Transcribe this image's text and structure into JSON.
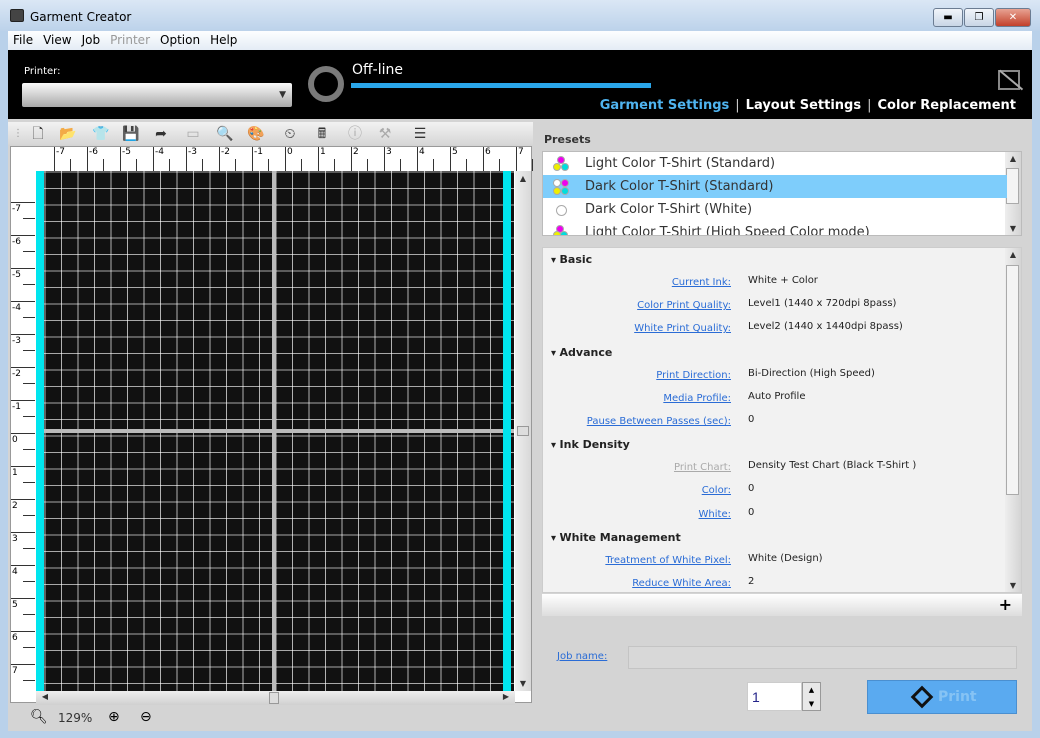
{
  "window": {
    "title": "Garment Creator",
    "minimize": "▬",
    "maximize": "❐",
    "close": "✕"
  },
  "menu": [
    "File",
    "View",
    "Job",
    "Printer",
    "Option",
    "Help"
  ],
  "menu_disabled": [
    "Printer"
  ],
  "header": {
    "printer_label": "Printer:",
    "printer_value": "",
    "status": "Off-line",
    "progress_percent": 100,
    "tabs": [
      {
        "label": "Garment Settings",
        "active": true
      },
      {
        "label": "Layout Settings",
        "active": false
      },
      {
        "label": "Color Replacement",
        "active": false
      }
    ]
  },
  "toolbar": [
    {
      "name": "new-icon",
      "glyph": "🗋"
    },
    {
      "name": "open-icon",
      "glyph": "📂"
    },
    {
      "name": "tshirt-icon",
      "glyph": "👕"
    },
    {
      "name": "save-icon",
      "glyph": "💾",
      "disabled": true
    },
    {
      "name": "export-icon",
      "glyph": "➦"
    },
    {
      "name": "frame-icon",
      "glyph": "▭",
      "disabled": true
    },
    {
      "name": "search-settings-icon",
      "glyph": "🔍"
    },
    {
      "name": "palette-icon",
      "glyph": "🎨"
    },
    {
      "name": "history-icon",
      "glyph": "⏲"
    },
    {
      "name": "calculator-icon",
      "glyph": "🖩"
    },
    {
      "name": "info-icon",
      "glyph": "ⓘ",
      "disabled": true
    },
    {
      "name": "maintenance-icon",
      "glyph": "⚒",
      "disabled": true
    },
    {
      "name": "checklist-icon",
      "glyph": "☰"
    }
  ],
  "ruler": {
    "top": [
      "-7",
      "-6",
      "-5",
      "-4",
      "-3",
      "-2",
      "-1",
      "0",
      "1",
      "2",
      "3",
      "4",
      "5",
      "6",
      "7"
    ],
    "left": [
      "-7",
      "-6",
      "-5",
      "-4",
      "-3",
      "-2",
      "-1",
      "0",
      "1",
      "2",
      "3",
      "4",
      "5",
      "6",
      "7"
    ]
  },
  "colors": {
    "platen": "#111111",
    "grid": "#ffffff",
    "guide": "#00e5ee",
    "accent": "#2aa6ea",
    "link": "#2a6cd6",
    "selected": "#7ecdfb",
    "print_button": "#5aaaf0"
  },
  "zoom": {
    "value": "129%"
  },
  "presets": {
    "label": "Presets",
    "items": [
      {
        "label": "Light Color T-Shirt (Standard)",
        "icon": "cmy-icon",
        "selected": false
      },
      {
        "label": "Dark Color T-Shirt (Standard)",
        "icon": "wcmy-icon",
        "selected": true
      },
      {
        "label": "Dark Color T-Shirt (White)",
        "icon": "white-circle-icon",
        "selected": false
      },
      {
        "label": "Light Color T-Shirt (High Speed Color mode)",
        "icon": "cmy-x2-icon",
        "selected": false
      }
    ]
  },
  "settings": [
    {
      "section": "Basic",
      "rows": [
        {
          "label": "Current Ink:",
          "value": "White + Color"
        },
        {
          "label": "Color Print Quality:",
          "value": "Level1 (1440 x 720dpi 8pass)"
        },
        {
          "label": "White Print Quality:",
          "value": "Level2 (1440 x 1440dpi 8pass)"
        }
      ]
    },
    {
      "section": "Advance",
      "rows": [
        {
          "label": "Print Direction:",
          "value": "Bi-Direction (High Speed)"
        },
        {
          "label": "Media Profile:",
          "value": "Auto Profile"
        },
        {
          "label": "Pause Between Passes (sec):",
          "value": "0"
        }
      ]
    },
    {
      "section": "Ink Density",
      "rows": [
        {
          "label": "Print Chart:",
          "value": "Density Test Chart (Black T-Shirt )",
          "disabled": true
        },
        {
          "label": "Color:",
          "value": "0"
        },
        {
          "label": "White:",
          "value": "0"
        }
      ]
    },
    {
      "section": "White Management",
      "rows": [
        {
          "label": "Treatment of White Pixel:",
          "value": "White (Design)"
        },
        {
          "label": "Reduce White Area:",
          "value": "2"
        }
      ]
    }
  ],
  "add_label": "+",
  "job": {
    "label": "Job name:",
    "value": ""
  },
  "copies": {
    "value": "1"
  },
  "print": {
    "label": "Print"
  }
}
